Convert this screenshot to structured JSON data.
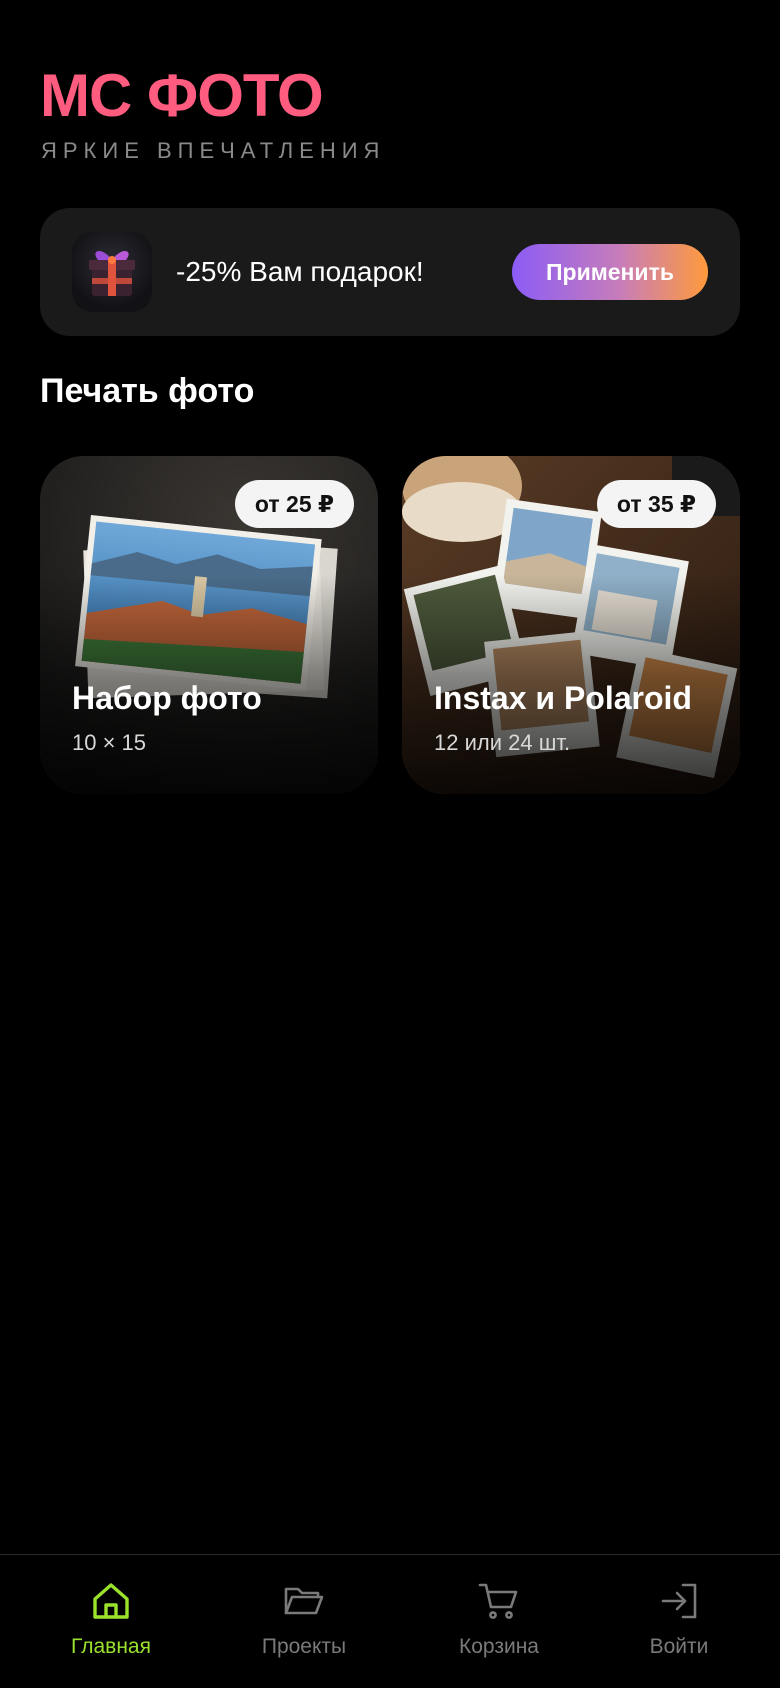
{
  "header": {
    "brand": "МС ФОТО",
    "tagline": "ЯРКИЕ ВПЕЧАТЛЕНИЯ"
  },
  "promo": {
    "icon": "gift-icon",
    "text": "-25% Вам подарок!",
    "button_label": "Применить"
  },
  "section": {
    "title": "Печать фото"
  },
  "products": [
    {
      "price": "от 25 ₽",
      "title": "Набор фото",
      "subtitle": "10 × 15"
    },
    {
      "price": "от 35 ₽",
      "title": "Instax и Polaroid",
      "subtitle": "12 или 24 шт."
    }
  ],
  "bottom_nav": {
    "items": [
      {
        "label": "Главная",
        "icon": "home-icon",
        "active": true
      },
      {
        "label": "Проекты",
        "icon": "folder-icon",
        "active": false
      },
      {
        "label": "Корзина",
        "icon": "cart-icon",
        "active": false
      },
      {
        "label": "Войти",
        "icon": "login-icon",
        "active": false
      }
    ]
  },
  "colors": {
    "brand": "#ff5c80",
    "active_nav": "#9be22d",
    "background": "#000000",
    "banner": "#1a1a1a"
  }
}
